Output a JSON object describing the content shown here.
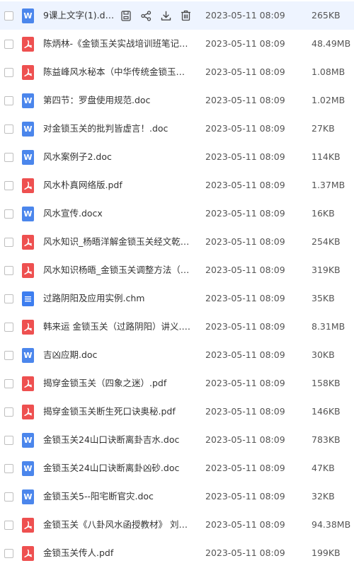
{
  "files": [
    {
      "name": "9课上文字(1).doc...",
      "date": "2023-05-11 08:09",
      "size": "265KB",
      "type": "doc",
      "icon_letter": "W",
      "selected": true
    },
    {
      "name": "陈炳林-《金锁玉关实战培训班笔记电...",
      "date": "2023-05-11 08:09",
      "size": "48.49MB",
      "type": "pdf"
    },
    {
      "name": "陈益峰风水秘本（中华传统金锁玉关...",
      "date": "2023-05-11 08:09",
      "size": "1.08MB",
      "type": "pdf"
    },
    {
      "name": "第四节：罗盘使用规范.doc",
      "date": "2023-05-11 08:09",
      "size": "1.02MB",
      "type": "doc",
      "icon_letter": "W"
    },
    {
      "name": "对金锁玉关的批判皆虚言！.doc",
      "date": "2023-05-11 08:09",
      "size": "27KB",
      "type": "doc",
      "icon_letter": "W"
    },
    {
      "name": "风水案例子2.doc",
      "date": "2023-05-11 08:09",
      "size": "114KB",
      "type": "doc",
      "icon_letter": "W"
    },
    {
      "name": "风水朴真网络版.pdf",
      "date": "2023-05-11 08:09",
      "size": "1.37MB",
      "type": "pdf"
    },
    {
      "name": "风水宣传.docx",
      "date": "2023-05-11 08:09",
      "size": "16KB",
      "type": "doc",
      "icon_letter": "W"
    },
    {
      "name": "风水知识_杨晤洋解金锁玉关经文乾卦...",
      "date": "2023-05-11 08:09",
      "size": "254KB",
      "type": "pdf"
    },
    {
      "name": "风水知识杨晤_金锁玉关调整方法（20...",
      "date": "2023-05-11 08:09",
      "size": "319KB",
      "type": "pdf"
    },
    {
      "name": "过路阴阳及应用实例.chm",
      "date": "2023-05-11 08:09",
      "size": "35KB",
      "type": "chm"
    },
    {
      "name": "韩来运 金锁玉关（过路阴阳）讲义.pdf",
      "date": "2023-05-11 08:09",
      "size": "8.31MB",
      "type": "pdf"
    },
    {
      "name": "吉凶应期.doc",
      "date": "2023-05-11 08:09",
      "size": "30KB",
      "type": "doc",
      "icon_letter": "W"
    },
    {
      "name": "揭穿金锁玉关（四象之迷）.pdf",
      "date": "2023-05-11 08:09",
      "size": "158KB",
      "type": "pdf"
    },
    {
      "name": "揭穿金锁玉关断生死口诀奥秘.pdf",
      "date": "2023-05-11 08:09",
      "size": "146KB",
      "type": "pdf"
    },
    {
      "name": "金锁玉关24山口诀断离卦吉水.doc",
      "date": "2023-05-11 08:09",
      "size": "783KB",
      "type": "doc",
      "icon_letter": "W"
    },
    {
      "name": "金锁玉关24山口诀断离卦凶砂.doc",
      "date": "2023-05-11 08:09",
      "size": "47KB",
      "type": "doc",
      "icon_letter": "W"
    },
    {
      "name": "金锁玉关5--阳宅断官灾.doc",
      "date": "2023-05-11 08:09",
      "size": "32KB",
      "type": "doc",
      "icon_letter": "W"
    },
    {
      "name": "金锁玉关《八卦风水函授教材》 刘东...",
      "date": "2023-05-11 08:09",
      "size": "94.38MB",
      "type": "pdf"
    },
    {
      "name": "金锁玉关传人.pdf",
      "date": "2023-05-11 08:09",
      "size": "199KB",
      "type": "pdf"
    }
  ],
  "row_actions": [
    {
      "icon": "save-to-cloud-icon"
    },
    {
      "icon": "share-icon"
    },
    {
      "icon": "download-icon"
    },
    {
      "icon": "delete-icon"
    }
  ],
  "colors": {
    "doc_icon": "#4b86ec",
    "pdf_icon": "#ee5050",
    "chm_icon": "#3d7ef0",
    "selected_row": "#eef4ff",
    "action_icon": "#4a4a4a"
  }
}
